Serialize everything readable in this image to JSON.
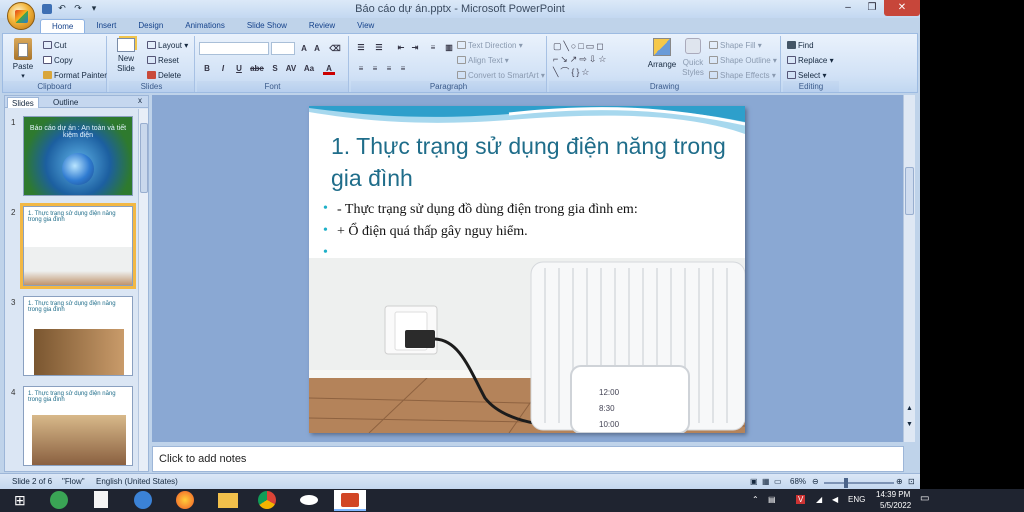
{
  "window": {
    "title": "Báo cáo dự án.pptx - Microsoft PowerPoint",
    "buttons": {
      "minimize": "–",
      "restore": "❐",
      "close": "✕"
    }
  },
  "tabs": [
    "Home",
    "Insert",
    "Design",
    "Animations",
    "Slide Show",
    "Review",
    "View"
  ],
  "ribbon": {
    "clipboard": {
      "label": "Clipboard",
      "paste": "Paste",
      "cut": "Cut",
      "copy": "Copy",
      "format_painter": "Format Painter"
    },
    "slides": {
      "label": "Slides",
      "new_slide": "New Slide",
      "layout": "Layout",
      "reset": "Reset",
      "delete": "Delete"
    },
    "font": {
      "label": "Font",
      "bold": "B",
      "italic": "I",
      "underline": "U",
      "strike": "abe",
      "shadow": "S"
    },
    "paragraph": {
      "label": "Paragraph",
      "text_direction": "Text Direction",
      "align_text": "Align Text",
      "convert_smartart": "Convert to SmartArt"
    },
    "drawing": {
      "label": "Drawing",
      "arrange": "Arrange",
      "quick_styles": "Quick Styles",
      "shape_fill": "Shape Fill",
      "shape_outline": "Shape Outline",
      "shape_effects": "Shape Effects"
    },
    "editing": {
      "label": "Editing",
      "find": "Find",
      "replace": "Replace",
      "select": "Select"
    }
  },
  "pane": {
    "tab_slides": "Slides",
    "tab_outline": "Outline",
    "close": "x",
    "thumbs": [
      {
        "num": "1",
        "title": "Báo cáo dự án : An toàn và tiết kiệm điện"
      },
      {
        "num": "2",
        "title": "1. Thực trạng sử dụng điện năng trong gia đình"
      },
      {
        "num": "3",
        "title": "1. Thực trạng sử dụng điện năng trong gia đình"
      },
      {
        "num": "4",
        "title": "1. Thực trạng sử dụng điện năng trong gia đình"
      }
    ]
  },
  "slide": {
    "title": "1.  Thực trạng sử dụng điện năng trong gia đình",
    "bullets": [
      "- Thực trạng sử dụng đồ dùng điện trong gia đình em:",
      "+ Ổ điện quá thấp gây nguy hiểm.",
      ""
    ],
    "phone_times": [
      "12:00",
      "8:30",
      "10:00"
    ]
  },
  "notes": {
    "placeholder": "Click to add notes"
  },
  "status": {
    "slide_info": "Slide 2 of 6",
    "theme": "\"Flow\"",
    "language": "English (United States)",
    "zoom": "68%"
  },
  "taskbar": {
    "lang": "ENG",
    "time": "14:39 PM",
    "date": "5/5/2022"
  },
  "colors": {
    "accent": "#1f6d8a",
    "bullet": "#1eb0c8",
    "ribbon": "#d2e2f6"
  }
}
